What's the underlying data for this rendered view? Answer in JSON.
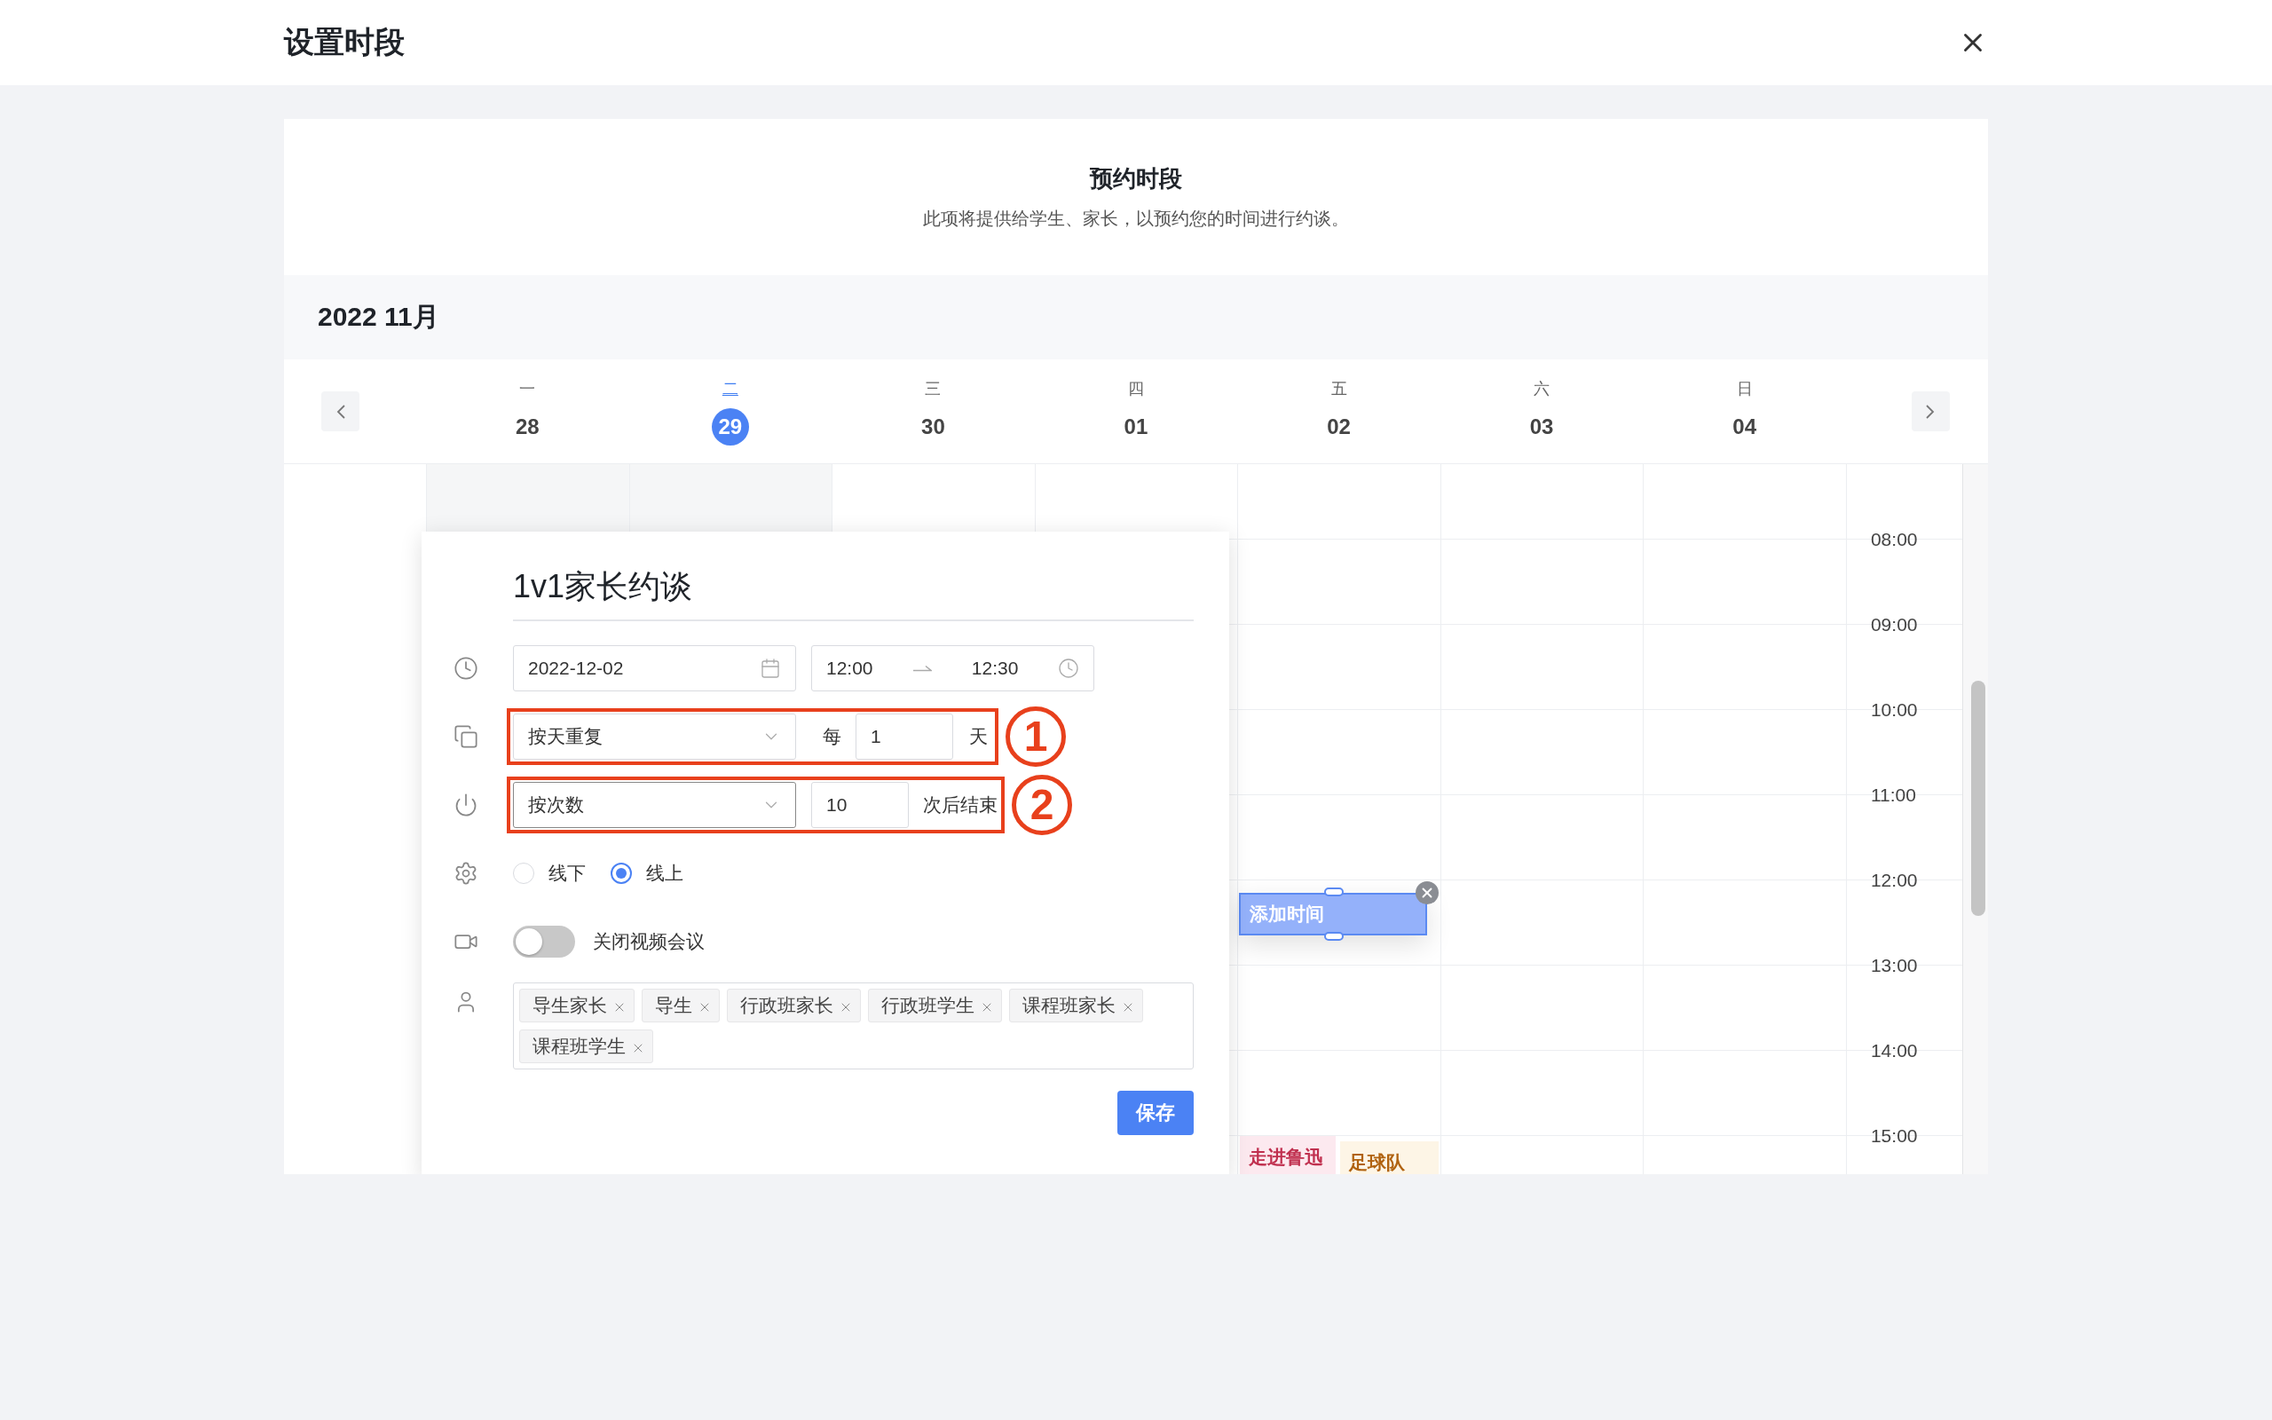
{
  "top_bar": {
    "title": "设置时段"
  },
  "header": {
    "title": "预约时段",
    "subtitle": "此项将提供给学生、家长，以预约您的时间进行约谈。"
  },
  "month_label": "2022 11月",
  "week": [
    {
      "weekday": "一",
      "date": "28",
      "selected": false
    },
    {
      "weekday": "二",
      "date": "29",
      "selected": true
    },
    {
      "weekday": "三",
      "date": "30",
      "selected": false
    },
    {
      "weekday": "四",
      "date": "01",
      "selected": false
    },
    {
      "weekday": "五",
      "date": "02",
      "selected": false
    },
    {
      "weekday": "六",
      "date": "03",
      "selected": false
    },
    {
      "weekday": "日",
      "date": "04",
      "selected": false
    }
  ],
  "time_labels": [
    "08:00",
    "09:00",
    "10:00",
    "11:00",
    "12:00",
    "13:00",
    "14:00",
    "15:00"
  ],
  "form": {
    "title": "1v1家长约谈",
    "date": "2022-12-02",
    "time_start": "12:00",
    "time_end": "12:30",
    "repeat": {
      "select": "按天重复",
      "every": "每",
      "value": "1",
      "unit": "天",
      "annotation": "1"
    },
    "end": {
      "select": "按次数",
      "value": "10",
      "suffix": "次后结束",
      "annotation": "2"
    },
    "mode": [
      {
        "label": "线下",
        "selected": false
      },
      {
        "label": "线上",
        "selected": true
      }
    ],
    "video": {
      "on": false,
      "label": "关闭视频会议"
    },
    "tags": [
      "导生家长",
      "导生",
      "行政班家长",
      "行政班学生",
      "课程班家长",
      "课程班学生"
    ],
    "save": "保存"
  },
  "add_time": {
    "label": "添加时间"
  },
  "events": [
    {
      "title": "走进鲁迅",
      "color": "#c0304f"
    },
    {
      "title": "足球队",
      "color": "#b0620f"
    }
  ]
}
